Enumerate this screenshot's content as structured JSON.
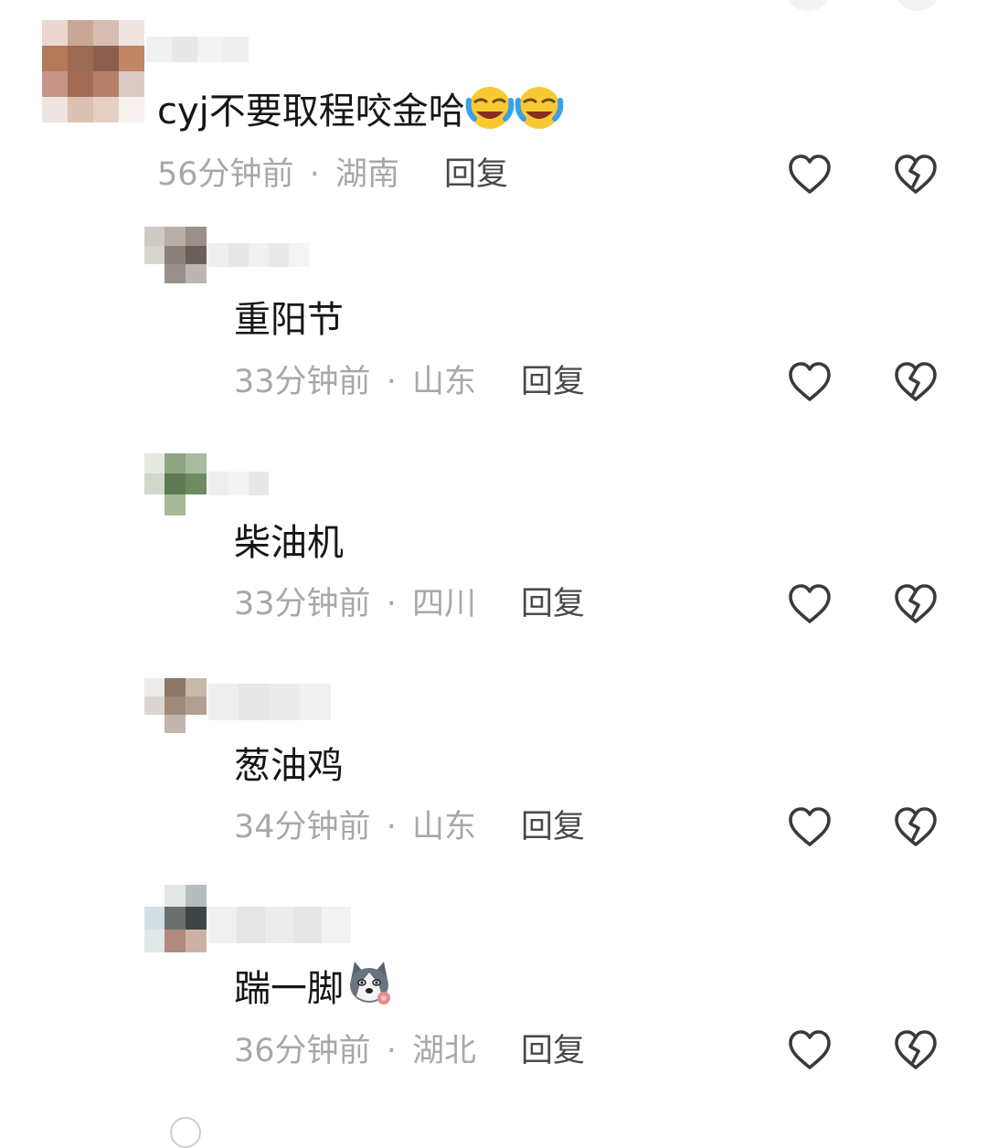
{
  "comments": [
    {
      "text": "cyj不要取程咬金哈",
      "time": "56分钟前",
      "location": "湖南",
      "reply_label": "回复",
      "emojis": [
        "laughing-crying-emoji",
        "laughing-crying-emoji"
      ]
    },
    {
      "text": "重阳节",
      "time": "33分钟前",
      "location": "山东",
      "reply_label": "回复"
    },
    {
      "text": "柴油机",
      "time": "33分钟前",
      "location": "四川",
      "reply_label": "回复"
    },
    {
      "text": "葱油鸡",
      "time": "34分钟前",
      "location": "山东",
      "reply_label": "回复"
    },
    {
      "text": "踹一脚",
      "time": "36分钟前",
      "location": "湖北",
      "reply_label": "回复",
      "emojis": [
        "husky-dog-emoji"
      ]
    }
  ],
  "meta_separator": "·",
  "icons": {
    "like": "heart-outline-icon",
    "dislike": "broken-heart-icon"
  },
  "colors": {
    "text": "#161616",
    "meta": "#a8a8a8",
    "reply": "#4a4a4a",
    "icon": "#3a3a3a"
  }
}
